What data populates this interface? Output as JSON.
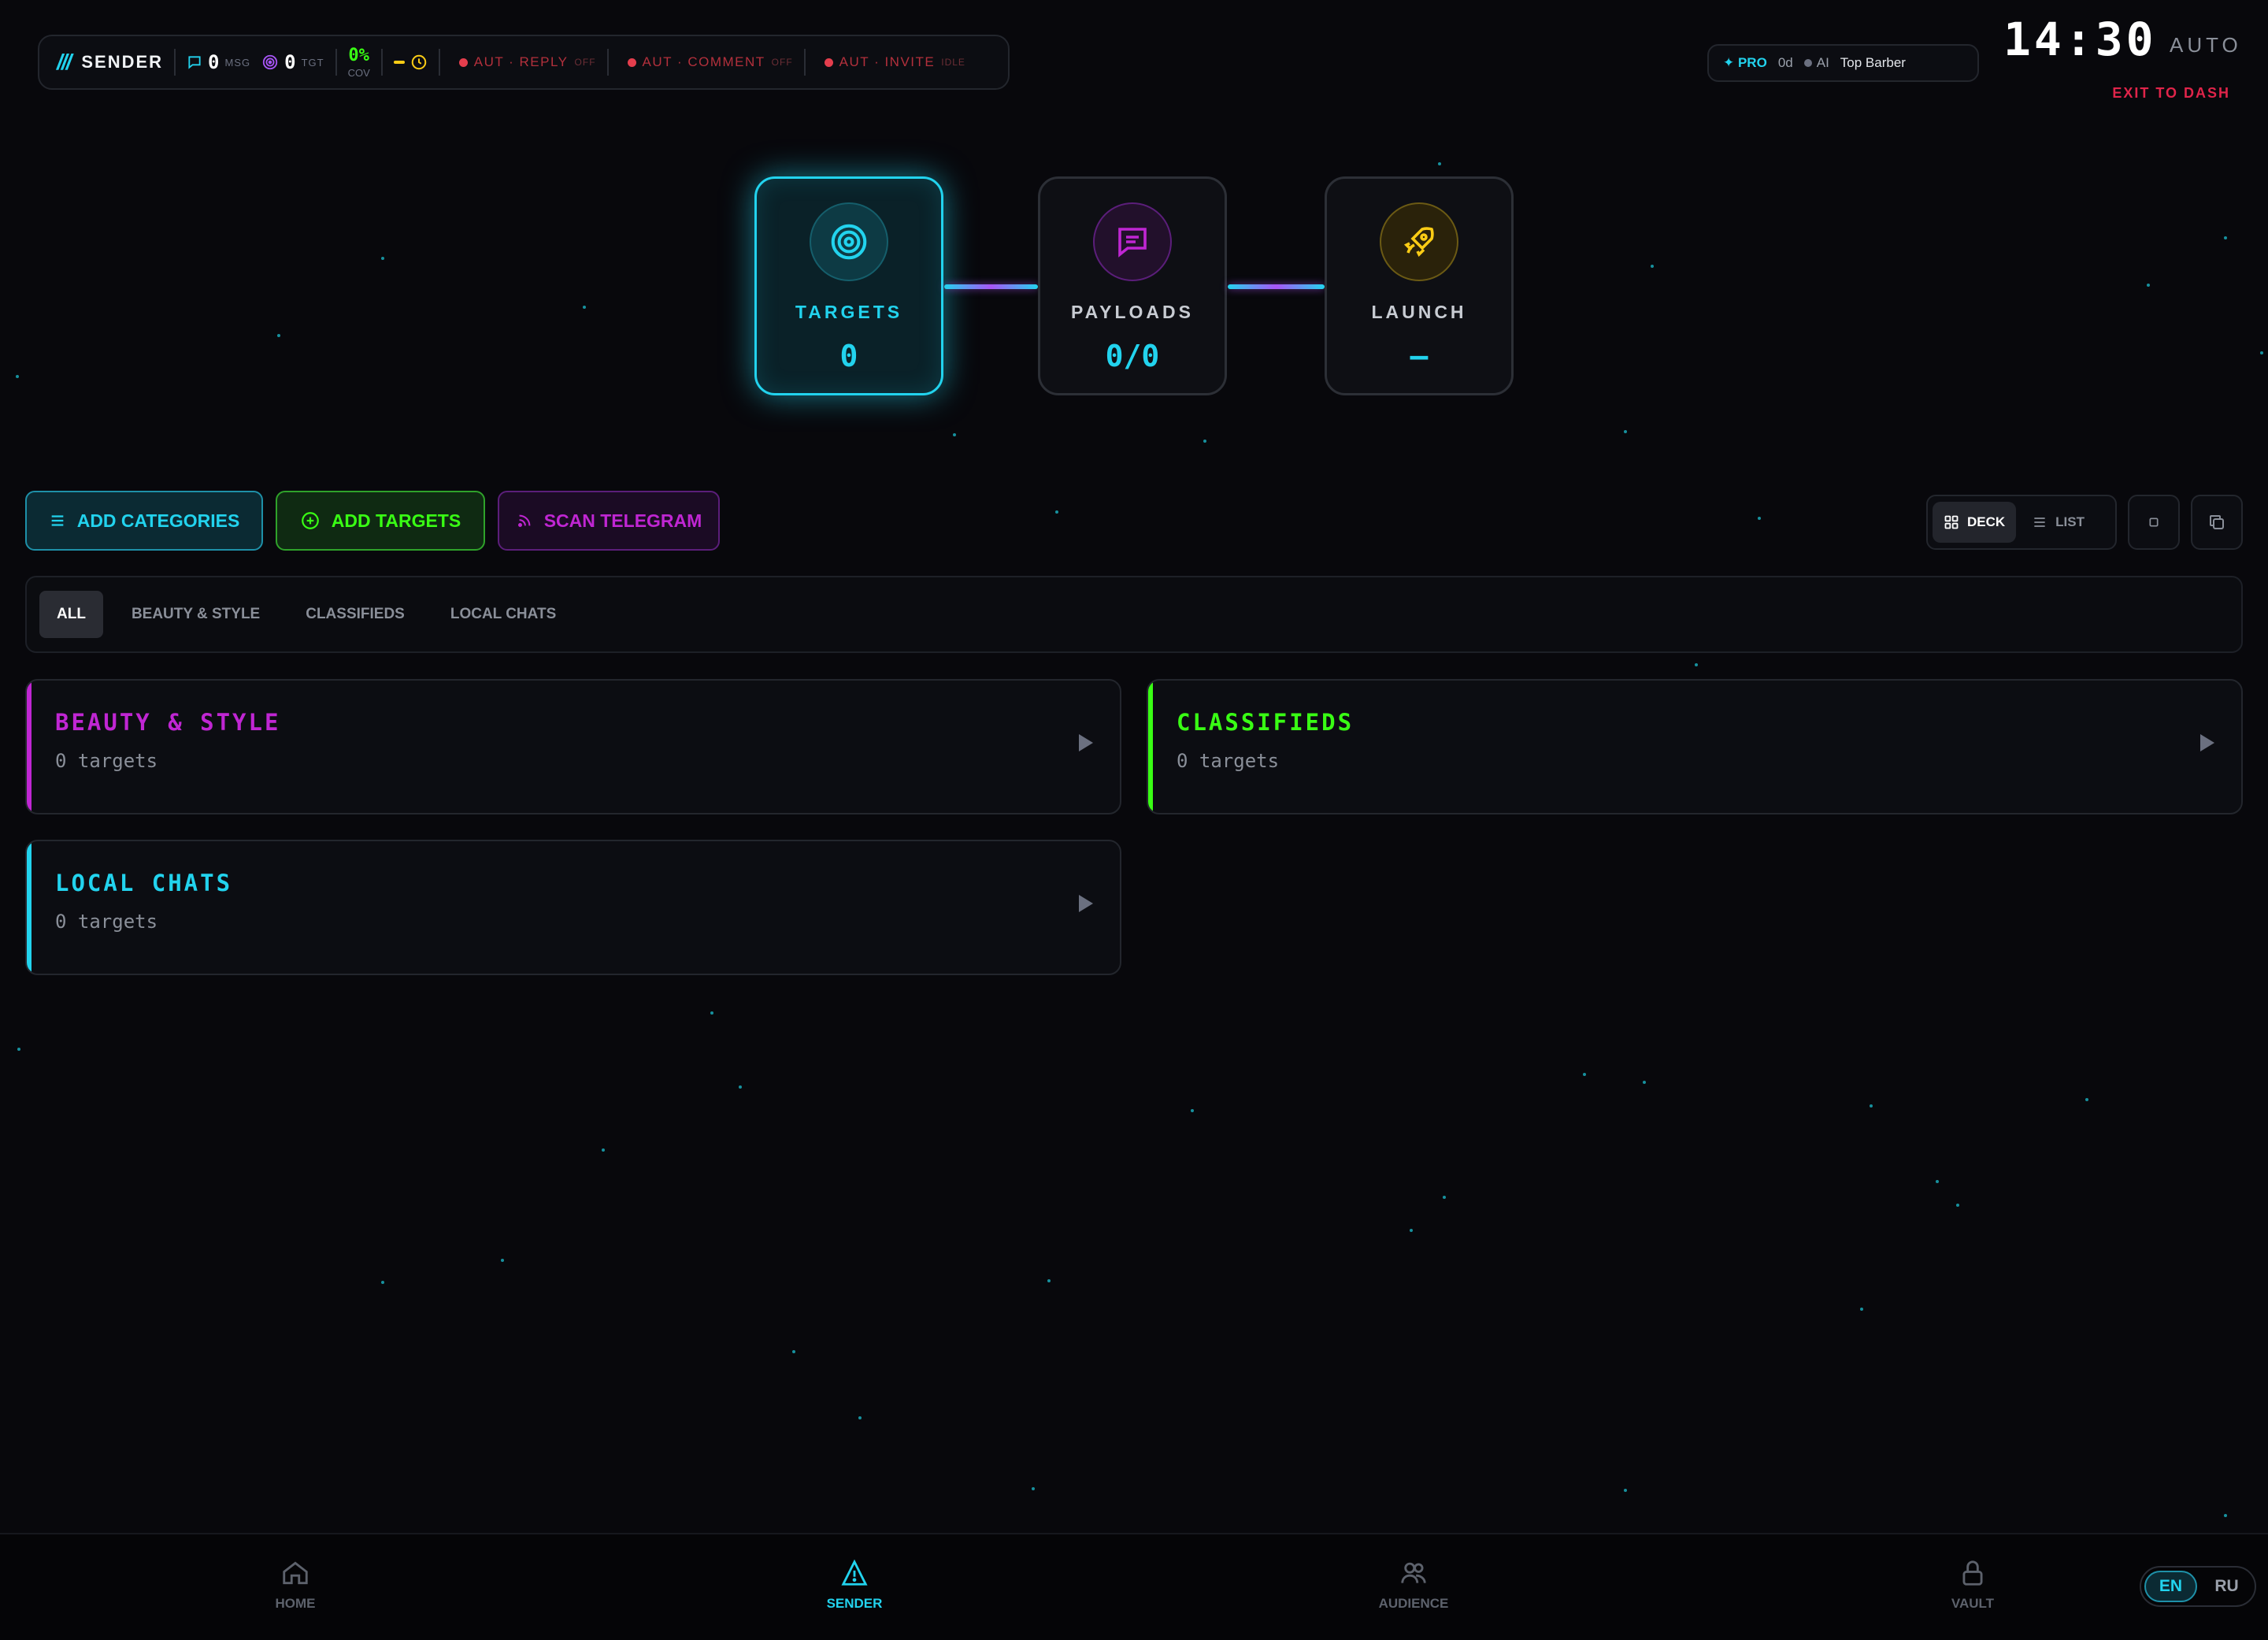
{
  "topbar": {
    "brand": "SENDER",
    "msg_count": "0",
    "msg_label": "MSG",
    "tgt_count": "0",
    "tgt_label": "TGT",
    "coverage": "0%",
    "coverage_label": "COV",
    "automations": [
      {
        "name": "AUT · REPLY",
        "state": "OFF"
      },
      {
        "name": "AUT · COMMENT",
        "state": "OFF"
      },
      {
        "name": "AUT · INVITE",
        "state": "IDLE"
      }
    ]
  },
  "account": {
    "plan": "✦ PRO",
    "days": "0d",
    "ai": "AI",
    "user": "Top Barber"
  },
  "clock": "14:30",
  "mode": "AUTO",
  "exit_label": "EXIT TO DASH",
  "pipeline": [
    {
      "label": "TARGETS",
      "value": "0",
      "icon": "target-icon"
    },
    {
      "label": "PAYLOADS",
      "value": "0/0",
      "icon": "message-icon"
    },
    {
      "label": "LAUNCH",
      "value": "—",
      "icon": "rocket-icon"
    }
  ],
  "actions": {
    "add_categories": "ADD CATEGORIES",
    "add_targets": "ADD TARGETS",
    "scan_telegram": "SCAN TELEGRAM"
  },
  "view": {
    "deck": "DECK",
    "list": "LIST",
    "active": "DECK"
  },
  "filters": [
    "ALL",
    "BEAUTY & STYLE",
    "CLASSIFIEDS",
    "LOCAL CHATS"
  ],
  "categories": [
    {
      "title": "BEAUTY & STYLE",
      "count": "0 targets",
      "color": "#c026d3"
    },
    {
      "title": "CLASSIFIEDS",
      "count": "0 targets",
      "color": "#39ff14"
    },
    {
      "title": "LOCAL CHATS",
      "count": "0 targets",
      "color": "#22d3ee"
    }
  ],
  "nav": [
    {
      "label": "HOME",
      "icon": "home-icon"
    },
    {
      "label": "SENDER",
      "icon": "send-icon"
    },
    {
      "label": "AUDIENCE",
      "icon": "users-icon"
    },
    {
      "label": "VAULT",
      "icon": "lock-icon"
    }
  ],
  "languages": [
    "EN",
    "RU"
  ],
  "colors": {
    "cyan": "#22d3ee",
    "green": "#39ff14",
    "magenta": "#c026d3",
    "yellow": "#facc15",
    "red": "#e0244a"
  }
}
